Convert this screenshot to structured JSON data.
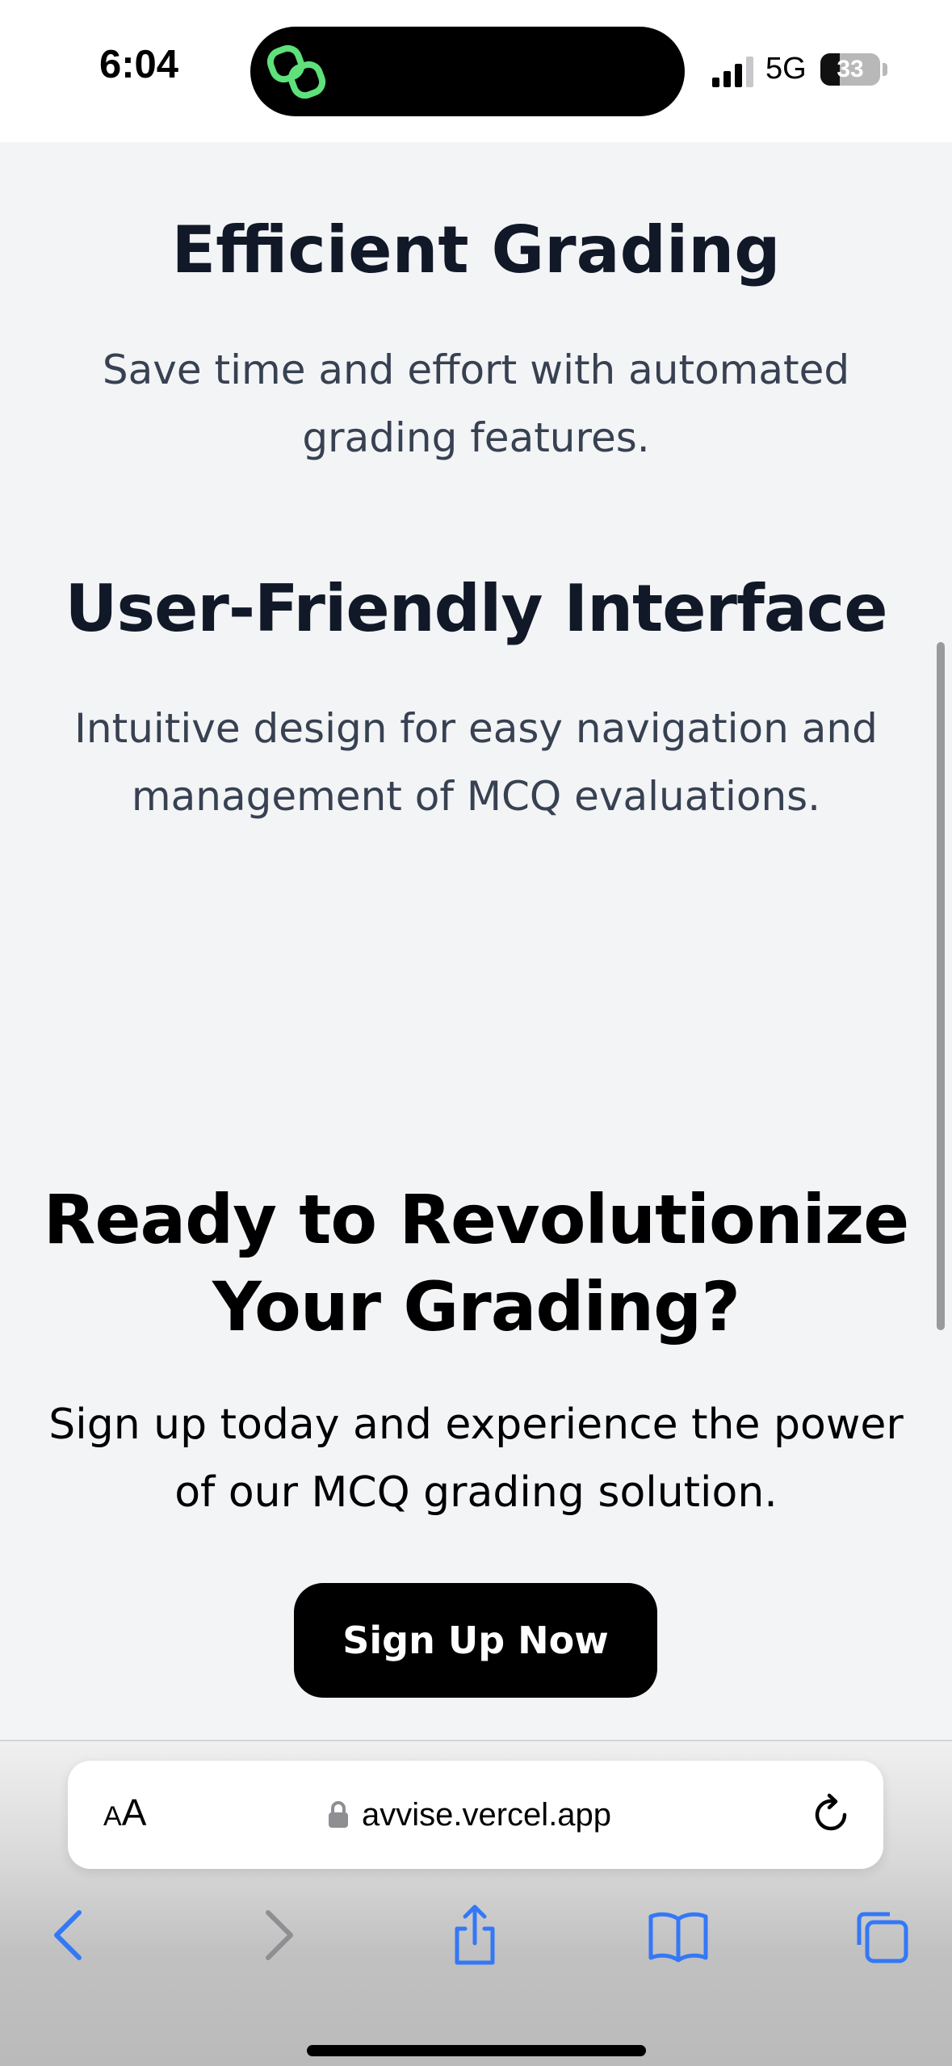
{
  "status_bar": {
    "time": "6:04",
    "network": "5G",
    "battery_percent": "33",
    "battery_level": 0.33
  },
  "features": [
    {
      "title": "Efficient Grading",
      "description": "Save time and effort with automated grading features."
    },
    {
      "title": "User-Friendly Interface",
      "description": "Intuitive design for easy navigation and management of MCQ evaluations."
    }
  ],
  "cta": {
    "title": "Ready to Revolutionize Your Grading?",
    "description": "Sign up today and experience the power of our MCQ grading solution.",
    "button_label": "Sign Up Now"
  },
  "browser": {
    "text_size_small": "A",
    "text_size_large": "A",
    "url": "avvise.vercel.app",
    "toolbar_icons": [
      "back-icon",
      "forward-icon",
      "share-icon",
      "bookmarks-icon",
      "tabs-icon"
    ]
  },
  "colors": {
    "page_background": "#f3f4f6",
    "heading": "#111827",
    "body_text": "#374151",
    "button_background": "#000000",
    "toolbar_accent": "#3478f6",
    "toolbar_disabled": "#8e8e93",
    "island_icon": "#5ee07a"
  }
}
